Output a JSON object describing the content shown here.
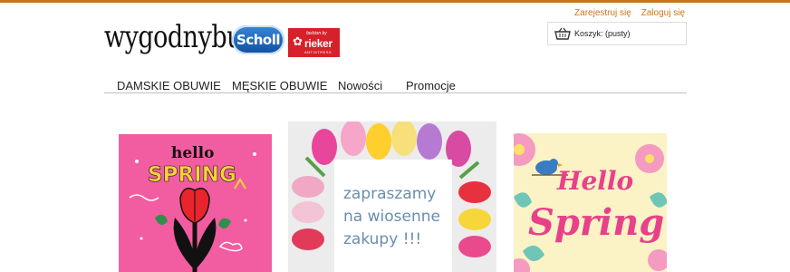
{
  "header": {
    "logo_text": "wygodnybut",
    "brands": {
      "scholl": "Scholl",
      "rieker_tagline": "fashion by",
      "rieker_name": "rieker",
      "rieker_sub": "ANTISTRESS"
    },
    "account": {
      "register_label": "Zarejestruj się",
      "login_label": "Zaloguj się"
    },
    "cart": {
      "label": "Koszyk: (pusty)"
    }
  },
  "nav": {
    "items": [
      {
        "label": "DAMSKIE OBUWIE"
      },
      {
        "label": "MĘSKIE OBUWIE"
      },
      {
        "label": "Nowości"
      },
      {
        "label": "Promocje"
      }
    ]
  },
  "banners": {
    "left": {
      "line1": "hello",
      "line2": "SPRING"
    },
    "center": {
      "text": "zapraszamy na wiosenne zakupy !!!"
    },
    "right": {
      "line1": "Hello",
      "line2": "Spring"
    }
  },
  "colors": {
    "accent": "#c9761a",
    "link": "#c9761a",
    "scholl_blue": "#1a62b5",
    "rieker_red": "#d6202a",
    "pink": "#f15da0"
  }
}
